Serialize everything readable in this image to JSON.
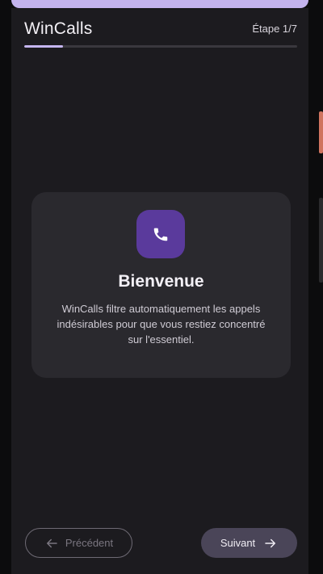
{
  "header": {
    "title": "WinCalls",
    "step": "Étape 1/7",
    "progress_fraction": 0.143
  },
  "welcome_card": {
    "icon": "phone-icon",
    "title": "Bienvenue",
    "description": "WinCalls filtre automatiquement les appels indésirables pour que vous restiez concentré sur l'essentiel."
  },
  "navigation": {
    "previous_label": "Précédent",
    "previous_icon": "arrow-left-icon",
    "next_label": "Suivant",
    "next_icon": "arrow-right-icon"
  },
  "colors": {
    "accent": "#c5b6f0",
    "icon_background": "#5a3a9c",
    "card_background": "#2a292e",
    "screen_background": "#1c1b1f"
  }
}
